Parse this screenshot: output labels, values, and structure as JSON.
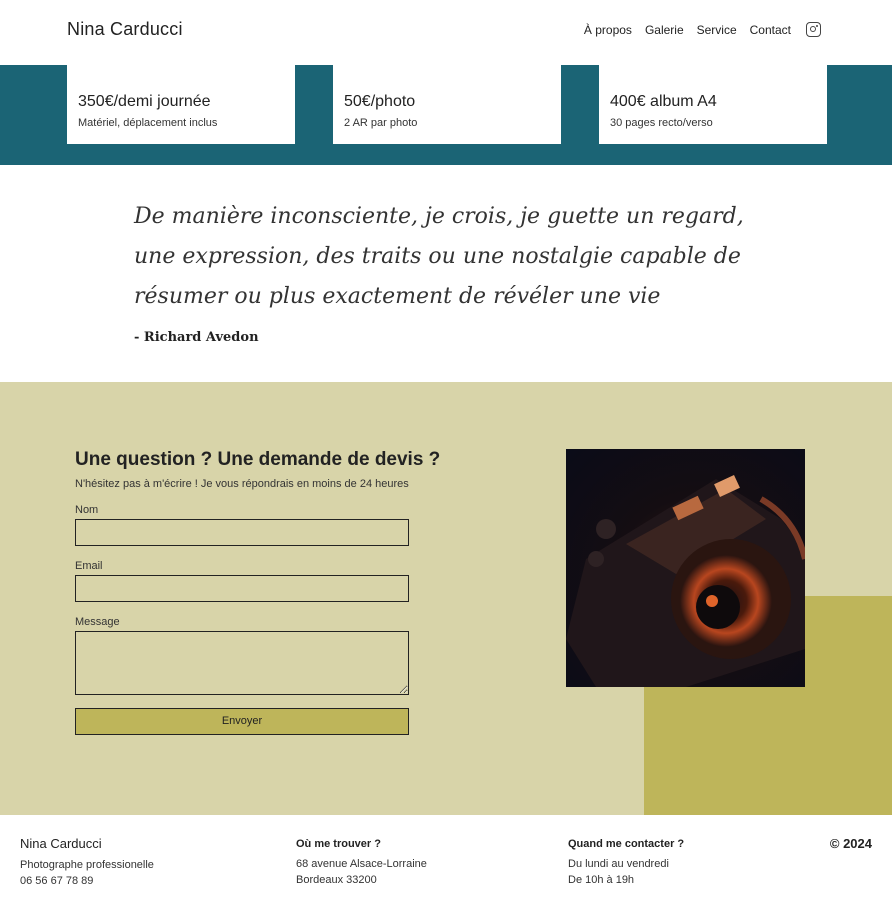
{
  "header": {
    "brand": "Nina Carducci",
    "nav": [
      "À propos",
      "Galerie",
      "Service",
      "Contact"
    ],
    "instagram_icon": "instagram-icon"
  },
  "pricing": {
    "cards": [
      {
        "price": "350€/demi journée",
        "detail": "Matériel, déplacement inclus"
      },
      {
        "price": "50€/photo",
        "detail": "2 AR par photo"
      },
      {
        "price": "400€ album A4",
        "detail": "30 pages recto/verso"
      }
    ]
  },
  "quote": {
    "text": "De manière inconsciente, je crois, je guette un regard, une expression, des traits ou une nostalgie capable de résumer ou plus exactement de révéler une vie",
    "author": "- Richard Avedon"
  },
  "contact": {
    "title": "Une question ? Une demande de devis ?",
    "subtitle": "N'hésitez pas à m'écrire ! Je vous répondrais en moins de 24 heures",
    "name_label": "Nom",
    "name_value": "",
    "email_label": "Email",
    "email_value": "",
    "message_label": "Message",
    "message_value": "",
    "submit_label": "Envoyer"
  },
  "footer": {
    "name": "Nina Carducci",
    "role": "Photographe professionelle",
    "phone": "06 56 67 78 89",
    "where_title": "Où me trouver ?",
    "address_line1": "68 avenue Alsace-Lorraine",
    "address_line2": "Bordeaux 33200",
    "when_title": "Quand me contacter ?",
    "when_line1": "Du lundi au vendredi",
    "when_line2": "De 10h à 19h",
    "copyright": "© 2024"
  },
  "colors": {
    "band": "#1b6475",
    "contact_bg": "#d8d4a9",
    "accent": "#beb55a"
  }
}
